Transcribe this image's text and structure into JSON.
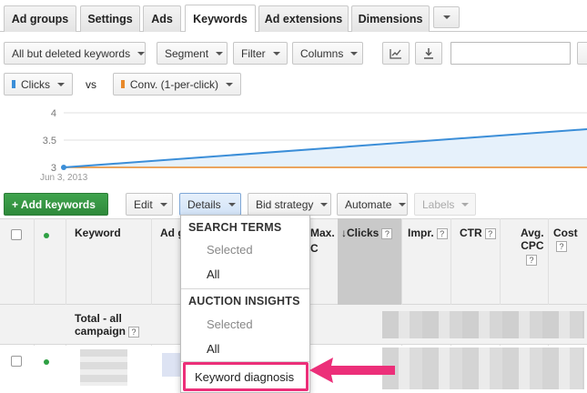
{
  "tabs": [
    {
      "label": "Ad groups",
      "active": false
    },
    {
      "label": "Settings",
      "active": false
    },
    {
      "label": "Ads",
      "active": false
    },
    {
      "label": "Keywords",
      "active": true
    },
    {
      "label": "Ad extensions",
      "active": false
    },
    {
      "label": "Dimensions",
      "active": false
    }
  ],
  "toolbar1": {
    "filter_view": "All but deleted keywords",
    "segment": "Segment",
    "filter": "Filter",
    "columns": "Columns",
    "chart_icon": "line-chart-icon",
    "download_icon": "download-icon",
    "search_value": ""
  },
  "metrics": {
    "metric1": "Clicks",
    "metric1_color": "#3b8ed8",
    "vs": "vs",
    "metric2": "Conv. (1-per-click)",
    "metric2_color": "#e8892a"
  },
  "chart_data": {
    "type": "line",
    "x": [
      "Jun 3, 2013",
      ""
    ],
    "series": [
      {
        "values": [
          3,
          3.7
        ],
        "color": "#3b8ed8"
      },
      {
        "values": [
          3,
          3
        ],
        "color": "#e8892a"
      }
    ],
    "ytick_labels": [
      "4",
      "3.5",
      "3"
    ],
    "xtick_label": "Jun 3, 2013",
    "ylim": [
      3,
      4
    ]
  },
  "toolbar2": {
    "add": "+ Add keywords",
    "edit": "Edit",
    "details": "Details",
    "bid_strategy": "Bid strategy",
    "automate": "Automate",
    "labels": "Labels"
  },
  "table": {
    "headers": {
      "keyword": "Keyword",
      "adgroup": "Ad g",
      "maxcpc": "Max.",
      "maxcpc2": "C",
      "clicks": "Clicks",
      "clicks_arrow": "↓",
      "impr": "Impr.",
      "ctr": "CTR",
      "avgcpc1": "Avg.",
      "avgcpc2": "CPC",
      "cost": "Cost"
    },
    "help": "?",
    "total_label1": "Total - all",
    "total_label2": "campaign"
  },
  "menu": {
    "section1": "SEARCH TERMS",
    "s1_selected": "Selected",
    "s1_all": "All",
    "section2": "AUCTION INSIGHTS",
    "s2_selected": "Selected",
    "s2_all": "All",
    "keyword_diagnosis": "Keyword diagnosis"
  }
}
